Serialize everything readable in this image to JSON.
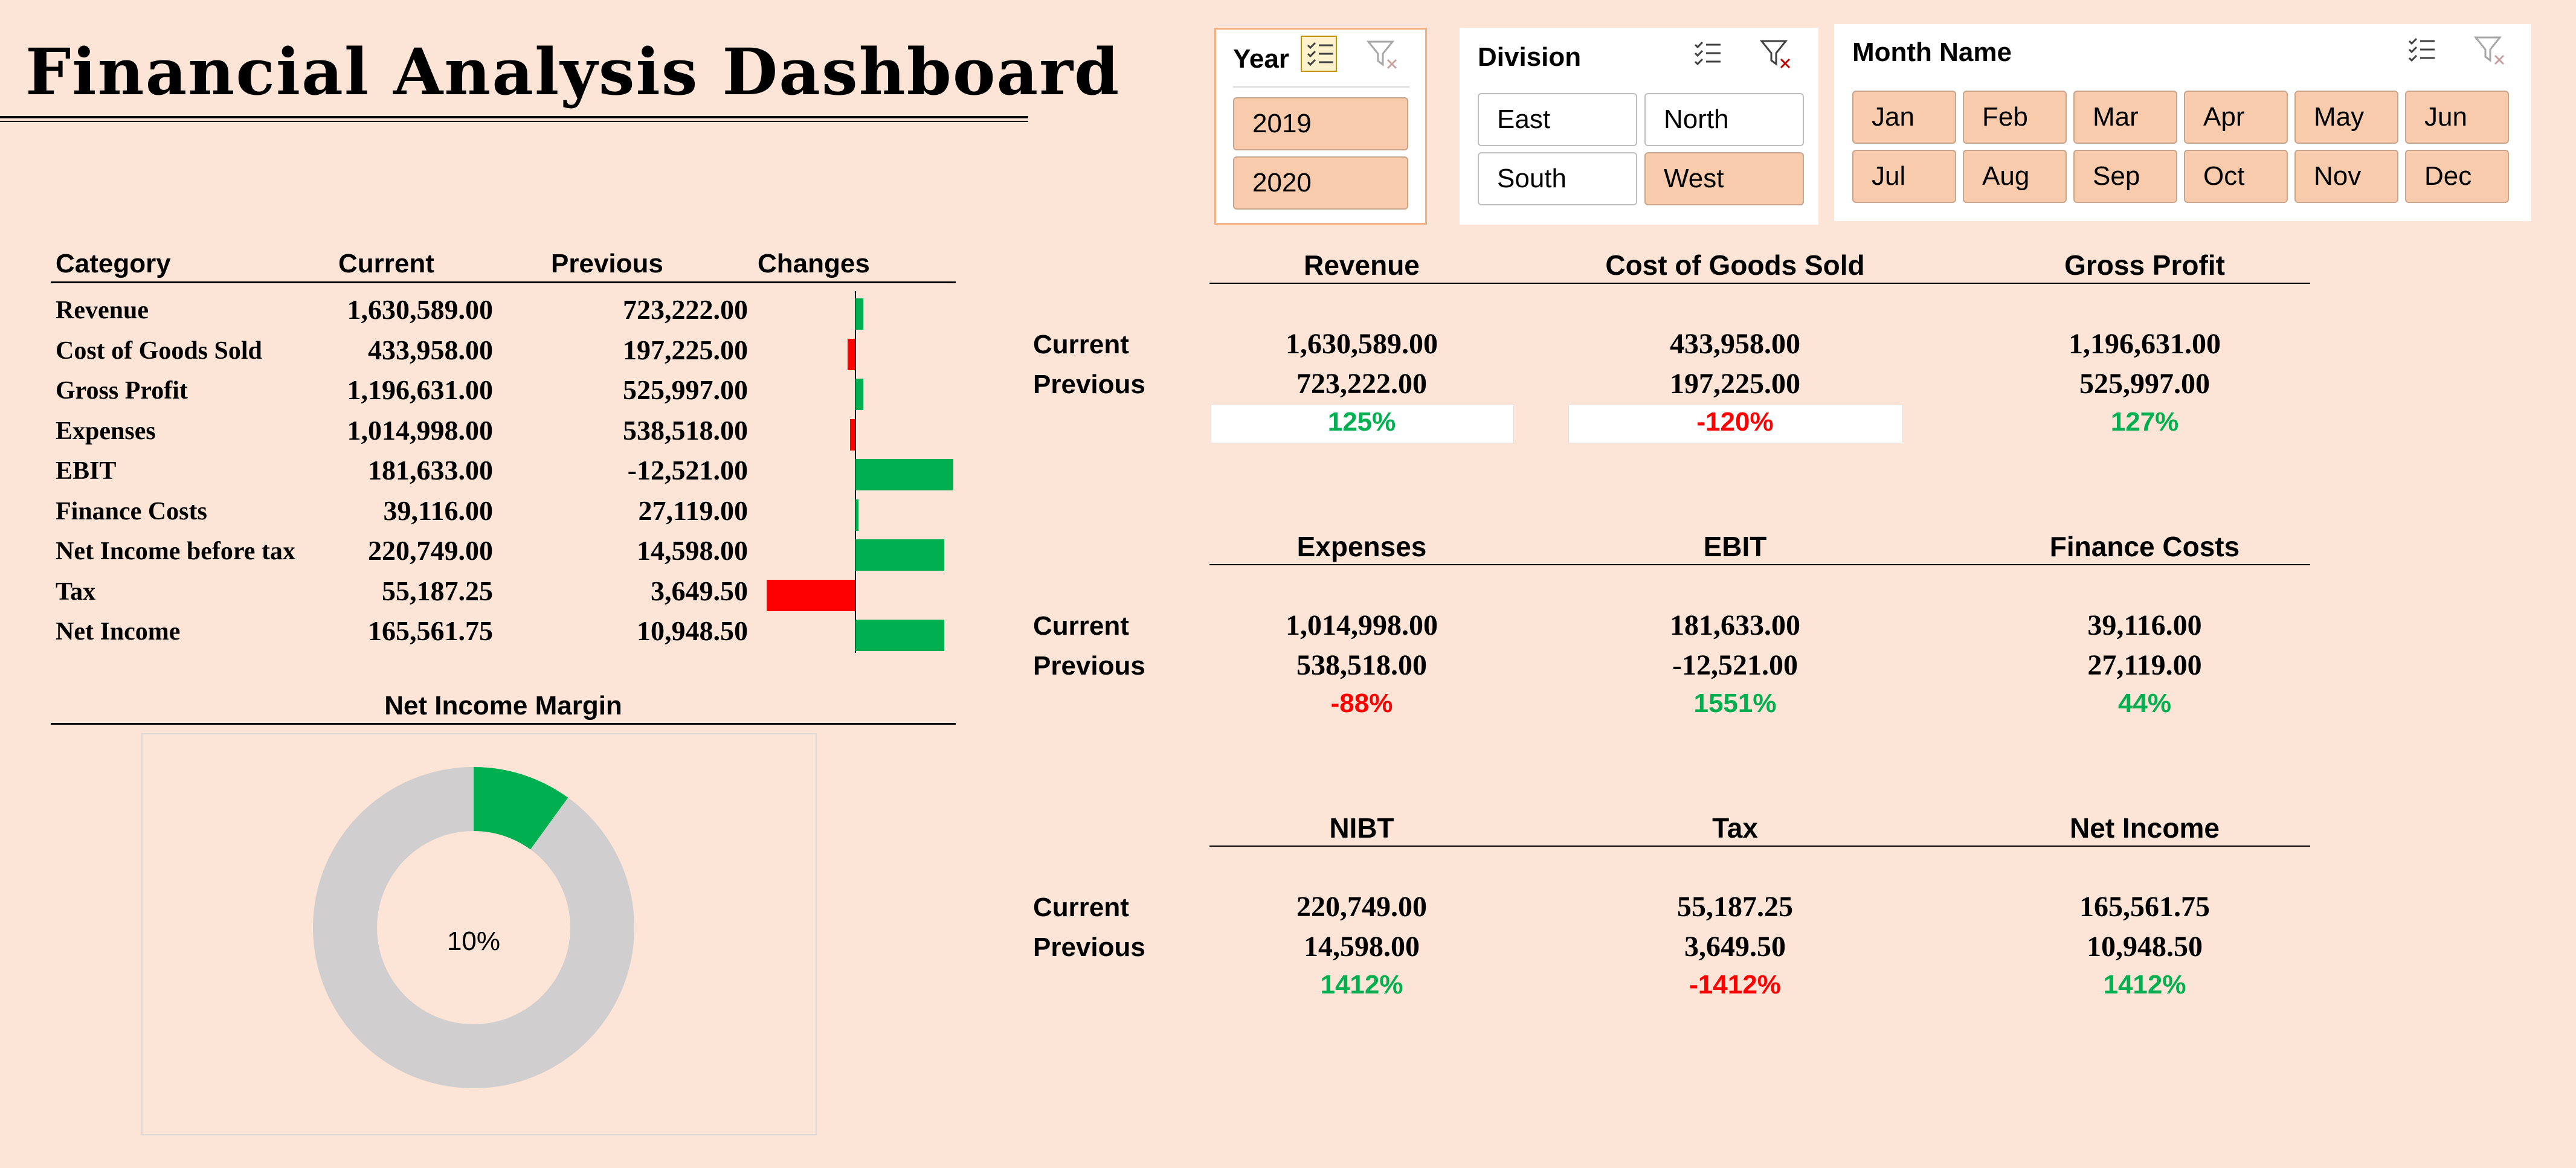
{
  "title": "Financial Analysis Dashboard",
  "slicers": {
    "year": {
      "header": "Year",
      "items": [
        {
          "label": "2019",
          "selected": true
        },
        {
          "label": "2020",
          "selected": true
        }
      ]
    },
    "division": {
      "header": "Division",
      "items": [
        {
          "label": "East",
          "selected": false
        },
        {
          "label": "North",
          "selected": false
        },
        {
          "label": "South",
          "selected": false
        },
        {
          "label": "West",
          "selected": true
        }
      ]
    },
    "month": {
      "header": "Month Name",
      "items": [
        {
          "label": "Jan",
          "selected": true
        },
        {
          "label": "Feb",
          "selected": true
        },
        {
          "label": "Mar",
          "selected": true
        },
        {
          "label": "Apr",
          "selected": true
        },
        {
          "label": "May",
          "selected": true
        },
        {
          "label": "Jun",
          "selected": true
        },
        {
          "label": "Jul",
          "selected": true
        },
        {
          "label": "Aug",
          "selected": true
        },
        {
          "label": "Sep",
          "selected": true
        },
        {
          "label": "Oct",
          "selected": true
        },
        {
          "label": "Nov",
          "selected": true
        },
        {
          "label": "Dec",
          "selected": true
        }
      ]
    },
    "icons": [
      "multi-select-icon",
      "clear-filter-icon"
    ]
  },
  "table": {
    "headers": {
      "category": "Category",
      "current": "Current",
      "previous": "Previous",
      "changes": "Changes"
    },
    "rows": [
      {
        "category": "Revenue",
        "current": "1,630,589.00",
        "previous": "723,222.00"
      },
      {
        "category": "Cost of Goods Sold",
        "current": "433,958.00",
        "previous": "197,225.00"
      },
      {
        "category": "Gross Profit",
        "current": "1,196,631.00",
        "previous": "525,997.00"
      },
      {
        "category": "Expenses",
        "current": "1,014,998.00",
        "previous": "538,518.00"
      },
      {
        "category": "EBIT",
        "current": "181,633.00",
        "previous": "-12,521.00"
      },
      {
        "category": "Finance Costs",
        "current": "39,116.00",
        "previous": "27,119.00"
      },
      {
        "category": "Net Income before tax",
        "current": "220,749.00",
        "previous": "14,598.00"
      },
      {
        "category": "Tax",
        "current": "55,187.25",
        "previous": "3,649.50"
      },
      {
        "category": "Net Income",
        "current": "165,561.75",
        "previous": "10,948.50"
      }
    ]
  },
  "chart_data": [
    {
      "type": "bar",
      "orientation": "horizontal",
      "categories": [
        "Revenue",
        "Cost of Goods Sold",
        "Gross Profit",
        "Expenses",
        "EBIT",
        "Finance Costs",
        "Net Income before tax",
        "Tax",
        "Net Income"
      ],
      "values": [
        1.25,
        -1.2,
        1.27,
        -0.88,
        15.51,
        0.44,
        14.12,
        -14.12,
        14.12
      ],
      "value_unit": "ratio (change vs previous)",
      "xlim": [
        -15.51,
        15.51
      ],
      "colors": {
        "positive": "#00B050",
        "negative": "#FF0000"
      },
      "title": "",
      "xlabel": "",
      "ylabel": ""
    },
    {
      "type": "pie",
      "variant": "donut",
      "title": "Net Income Margin",
      "slices": [
        {
          "label": "Net Income Margin",
          "value": 10,
          "color": "#00B050"
        },
        {
          "label": "Remainder",
          "value": 90,
          "color": "#D0CECE"
        }
      ],
      "center_label": "10%"
    }
  ],
  "kpi": {
    "current_label": "Current",
    "previous_label": "Previous",
    "groups": [
      [
        {
          "name": "Revenue",
          "current": "1,630,589.00",
          "previous": "723,222.00",
          "change": "125%",
          "positive": true
        },
        {
          "name": "Cost of Goods Sold",
          "current": "433,958.00",
          "previous": "197,225.00",
          "change": "-120%",
          "positive": false
        },
        {
          "name": "Gross Profit",
          "current": "1,196,631.00",
          "previous": "525,997.00",
          "change": "127%",
          "positive": true
        }
      ],
      [
        {
          "name": "Expenses",
          "current": "1,014,998.00",
          "previous": "538,518.00",
          "change": "-88%",
          "positive": false
        },
        {
          "name": "EBIT",
          "current": "181,633.00",
          "previous": "-12,521.00",
          "change": "1551%",
          "positive": true
        },
        {
          "name": "Finance Costs",
          "current": "39,116.00",
          "previous": "27,119.00",
          "change": "44%",
          "positive": true
        }
      ],
      [
        {
          "name": "NIBT",
          "current": "220,749.00",
          "previous": "14,598.00",
          "change": "1412%",
          "positive": true
        },
        {
          "name": "Tax",
          "current": "55,187.25",
          "previous": "3,649.50",
          "change": "-1412%",
          "positive": false
        },
        {
          "name": "Net Income",
          "current": "165,561.75",
          "previous": "10,948.50",
          "change": "1412%",
          "positive": true
        }
      ]
    ]
  },
  "colors": {
    "background": "#FCE4D6",
    "slicer_selected": "#F8CBAD",
    "positive": "#00B050",
    "negative": "#FF0000",
    "donut_rest": "#D0CECE"
  }
}
